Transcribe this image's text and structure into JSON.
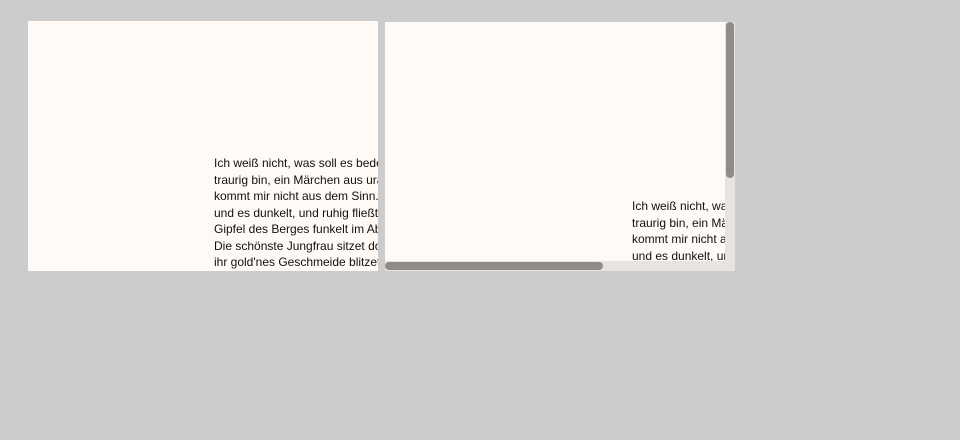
{
  "text": "Ich weiß nicht, was soll es bedeuten, dass ich so traurig bin, ein Märchen aus uralten Zeiten, das kommt mir nicht aus dem Sinn. Die Luft ist kühl und es dunkelt, und ruhig fließt der Rhein; der Gipfel des Berges funkelt im Abendsonnenschein. Die schönste Jungfrau sitzet dort oben wunderbar, ihr gold'nes Geschmeide blitzet, sie kämmt ihr goldenes Haar, sie kämmt es mit goldenem Kamme, und singt ein Lied dabei;",
  "colors": {
    "background": "#cccccc",
    "pane": "#fffaf5",
    "scrollbar_thumb": "#8f8b88",
    "scrollbar_track": "#e8e3de"
  }
}
